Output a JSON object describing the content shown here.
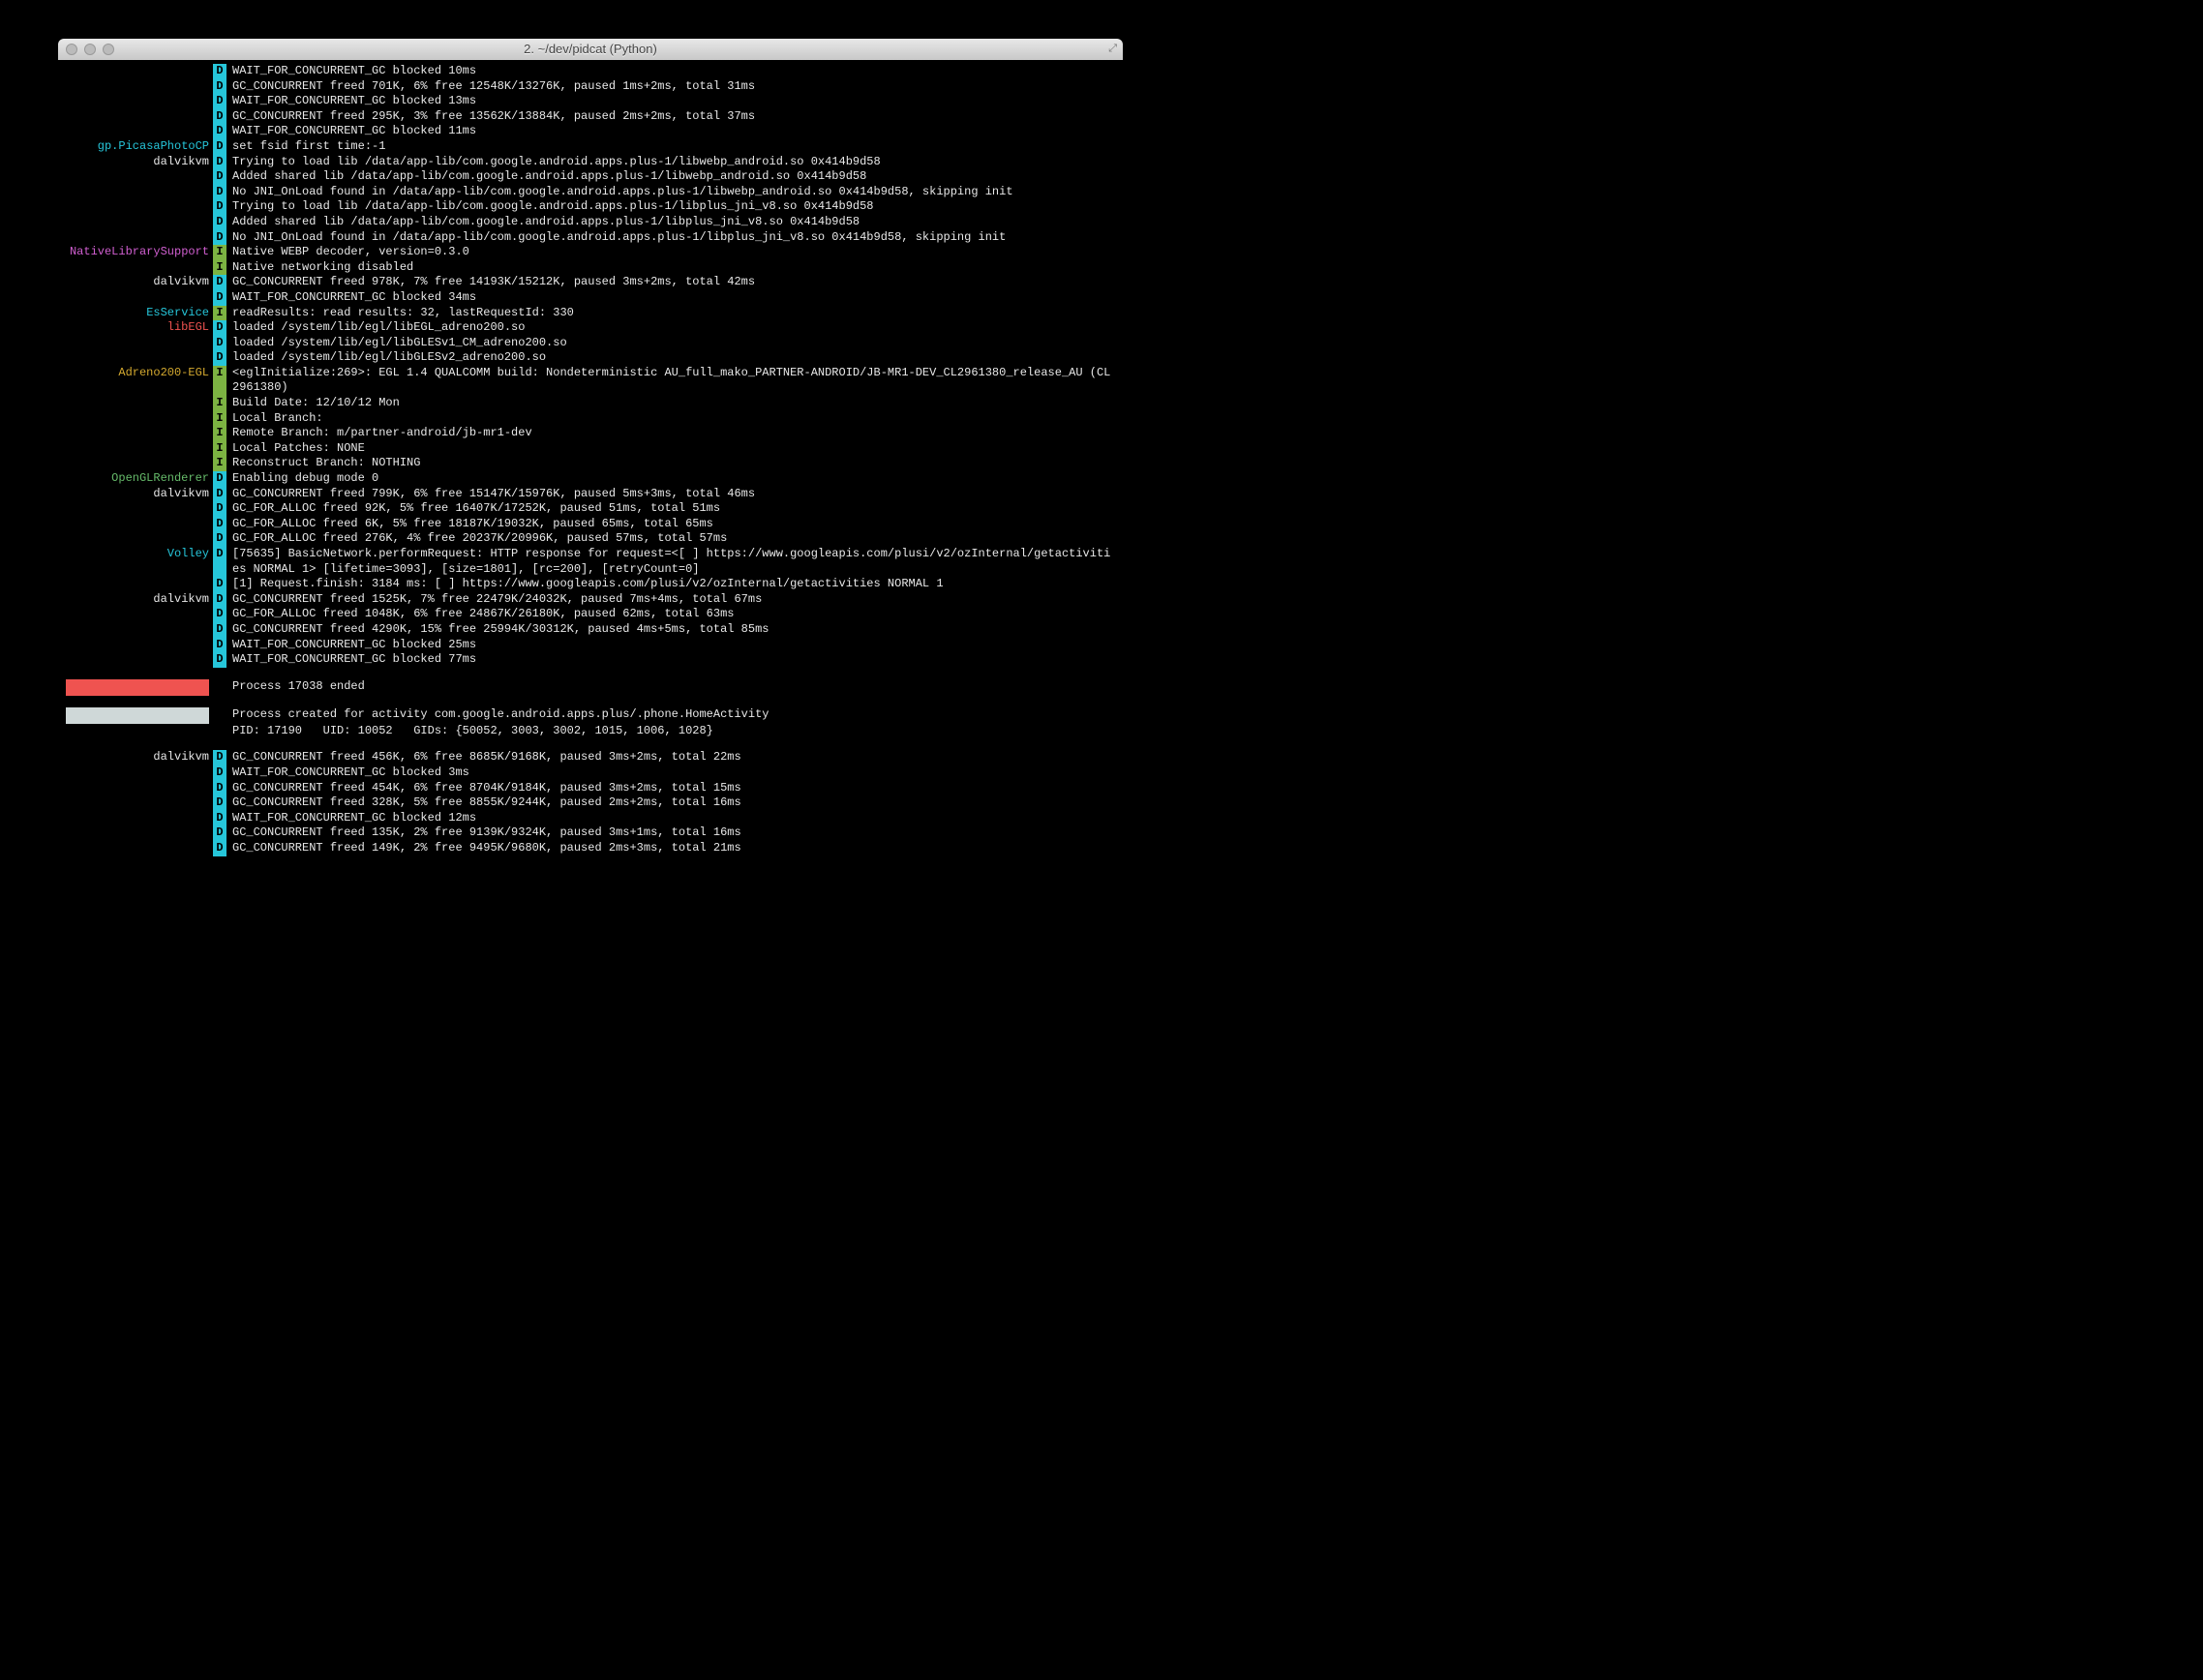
{
  "window": {
    "title": "2. ~/dev/pidcat (Python)"
  },
  "rows": [
    {
      "t": "row",
      "tag": "",
      "cls": "",
      "lvl": "D",
      "msg": "WAIT_FOR_CONCURRENT_GC blocked 10ms"
    },
    {
      "t": "row",
      "tag": "",
      "cls": "",
      "lvl": "D",
      "msg": "GC_CONCURRENT freed 701K, 6% free 12548K/13276K, paused 1ms+2ms, total 31ms"
    },
    {
      "t": "row",
      "tag": "",
      "cls": "",
      "lvl": "D",
      "msg": "WAIT_FOR_CONCURRENT_GC blocked 13ms"
    },
    {
      "t": "row",
      "tag": "",
      "cls": "",
      "lvl": "D",
      "msg": "GC_CONCURRENT freed 295K, 3% free 13562K/13884K, paused 2ms+2ms, total 37ms"
    },
    {
      "t": "row",
      "tag": "",
      "cls": "",
      "lvl": "D",
      "msg": "WAIT_FOR_CONCURRENT_GC blocked 11ms"
    },
    {
      "t": "row",
      "tag": "gp.PicasaPhotoCP",
      "cls": "cyan",
      "lvl": "D",
      "msg": "set fsid first time:-1"
    },
    {
      "t": "row",
      "tag": "dalvikvm",
      "cls": "white",
      "lvl": "D",
      "msg": "Trying to load lib /data/app-lib/com.google.android.apps.plus-1/libwebp_android.so 0x414b9d58"
    },
    {
      "t": "row",
      "tag": "",
      "cls": "",
      "lvl": "D",
      "msg": "Added shared lib /data/app-lib/com.google.android.apps.plus-1/libwebp_android.so 0x414b9d58"
    },
    {
      "t": "row",
      "tag": "",
      "cls": "",
      "lvl": "D",
      "msg": "No JNI_OnLoad found in /data/app-lib/com.google.android.apps.plus-1/libwebp_android.so 0x414b9d58, skipping init"
    },
    {
      "t": "row",
      "tag": "",
      "cls": "",
      "lvl": "D",
      "msg": "Trying to load lib /data/app-lib/com.google.android.apps.plus-1/libplus_jni_v8.so 0x414b9d58"
    },
    {
      "t": "row",
      "tag": "",
      "cls": "",
      "lvl": "D",
      "msg": "Added shared lib /data/app-lib/com.google.android.apps.plus-1/libplus_jni_v8.so 0x414b9d58"
    },
    {
      "t": "row",
      "tag": "",
      "cls": "",
      "lvl": "D",
      "msg": "No JNI_OnLoad found in /data/app-lib/com.google.android.apps.plus-1/libplus_jni_v8.so 0x414b9d58, skipping init"
    },
    {
      "t": "row",
      "tag": "NativeLibrarySupport",
      "cls": "magenta",
      "lvl": "I",
      "msg": "Native WEBP decoder, version=0.3.0"
    },
    {
      "t": "row",
      "tag": "",
      "cls": "",
      "lvl": "I",
      "msg": "Native networking disabled"
    },
    {
      "t": "row",
      "tag": "dalvikvm",
      "cls": "white",
      "lvl": "D",
      "msg": "GC_CONCURRENT freed 978K, 7% free 14193K/15212K, paused 3ms+2ms, total 42ms"
    },
    {
      "t": "row",
      "tag": "",
      "cls": "",
      "lvl": "D",
      "msg": "WAIT_FOR_CONCURRENT_GC blocked 34ms"
    },
    {
      "t": "row",
      "tag": "EsService",
      "cls": "cyan",
      "lvl": "I",
      "msg": "readResults: read results: 32, lastRequestId: 330"
    },
    {
      "t": "row",
      "tag": "libEGL",
      "cls": "red",
      "lvl": "D",
      "msg": "loaded /system/lib/egl/libEGL_adreno200.so"
    },
    {
      "t": "row",
      "tag": "",
      "cls": "",
      "lvl": "D",
      "msg": "loaded /system/lib/egl/libGLESv1_CM_adreno200.so"
    },
    {
      "t": "row",
      "tag": "",
      "cls": "",
      "lvl": "D",
      "msg": "loaded /system/lib/egl/libGLESv2_adreno200.so"
    },
    {
      "t": "row",
      "tag": "Adreno200-EGL",
      "cls": "yellow",
      "lvl": "I",
      "msg": "<eglInitialize:269>: EGL 1.4 QUALCOMM build: Nondeterministic AU_full_mako_PARTNER-ANDROID/JB-MR1-DEV_CL2961380_release_AU (CL2961380)"
    },
    {
      "t": "row",
      "tag": "",
      "cls": "",
      "lvl": "I",
      "msg": "Build Date: 12/10/12 Mon"
    },
    {
      "t": "row",
      "tag": "",
      "cls": "",
      "lvl": "I",
      "msg": "Local Branch:"
    },
    {
      "t": "row",
      "tag": "",
      "cls": "",
      "lvl": "I",
      "msg": "Remote Branch: m/partner-android/jb-mr1-dev"
    },
    {
      "t": "row",
      "tag": "",
      "cls": "",
      "lvl": "I",
      "msg": "Local Patches: NONE"
    },
    {
      "t": "row",
      "tag": "",
      "cls": "",
      "lvl": "I",
      "msg": "Reconstruct Branch: NOTHING"
    },
    {
      "t": "row",
      "tag": "OpenGLRenderer",
      "cls": "green",
      "lvl": "D",
      "msg": "Enabling debug mode 0"
    },
    {
      "t": "row",
      "tag": "dalvikvm",
      "cls": "white",
      "lvl": "D",
      "msg": "GC_CONCURRENT freed 799K, 6% free 15147K/15976K, paused 5ms+3ms, total 46ms"
    },
    {
      "t": "row",
      "tag": "",
      "cls": "",
      "lvl": "D",
      "msg": "GC_FOR_ALLOC freed 92K, 5% free 16407K/17252K, paused 51ms, total 51ms"
    },
    {
      "t": "row",
      "tag": "",
      "cls": "",
      "lvl": "D",
      "msg": "GC_FOR_ALLOC freed 6K, 5% free 18187K/19032K, paused 65ms, total 65ms"
    },
    {
      "t": "row",
      "tag": "",
      "cls": "",
      "lvl": "D",
      "msg": "GC_FOR_ALLOC freed 276K, 4% free 20237K/20996K, paused 57ms, total 57ms"
    },
    {
      "t": "row",
      "tag": "Volley",
      "cls": "cyan",
      "lvl": "D",
      "msg": "[75635] BasicNetwork.performRequest: HTTP response for request=<[ ] https://www.googleapis.com/plusi/v2/ozInternal/getactivities NORMAL 1> [lifetime=3093], [size=1801], [rc=200], [retryCount=0]"
    },
    {
      "t": "row",
      "tag": "",
      "cls": "",
      "lvl": "D",
      "msg": "[1] Request.finish: 3184 ms: [ ] https://www.googleapis.com/plusi/v2/ozInternal/getactivities NORMAL 1"
    },
    {
      "t": "row",
      "tag": "dalvikvm",
      "cls": "white",
      "lvl": "D",
      "msg": "GC_CONCURRENT freed 1525K, 7% free 22479K/24032K, paused 7ms+4ms, total 67ms"
    },
    {
      "t": "row",
      "tag": "",
      "cls": "",
      "lvl": "D",
      "msg": "GC_FOR_ALLOC freed 1048K, 6% free 24867K/26180K, paused 62ms, total 63ms"
    },
    {
      "t": "row",
      "tag": "",
      "cls": "",
      "lvl": "D",
      "msg": "GC_CONCURRENT freed 4290K, 15% free 25994K/30312K, paused 4ms+5ms, total 85ms"
    },
    {
      "t": "row",
      "tag": "",
      "cls": "",
      "lvl": "D",
      "msg": "WAIT_FOR_CONCURRENT_GC blocked 25ms"
    },
    {
      "t": "row",
      "tag": "",
      "cls": "",
      "lvl": "D",
      "msg": "WAIT_FOR_CONCURRENT_GC blocked 77ms"
    },
    {
      "t": "gap"
    },
    {
      "t": "banner",
      "color": "red",
      "msg": "Process 17038 ended"
    },
    {
      "t": "gap"
    },
    {
      "t": "banner",
      "color": "grey",
      "msg": "Process created for activity com.google.android.apps.plus/.phone.HomeActivity"
    },
    {
      "t": "plain",
      "msg": "PID: 17190   UID: 10052   GIDs: {50052, 3003, 3002, 1015, 1006, 1028}"
    },
    {
      "t": "gap"
    },
    {
      "t": "row",
      "tag": "dalvikvm",
      "cls": "white",
      "lvl": "D",
      "msg": "GC_CONCURRENT freed 456K, 6% free 8685K/9168K, paused 3ms+2ms, total 22ms"
    },
    {
      "t": "row",
      "tag": "",
      "cls": "",
      "lvl": "D",
      "msg": "WAIT_FOR_CONCURRENT_GC blocked 3ms"
    },
    {
      "t": "row",
      "tag": "",
      "cls": "",
      "lvl": "D",
      "msg": "GC_CONCURRENT freed 454K, 6% free 8704K/9184K, paused 3ms+2ms, total 15ms"
    },
    {
      "t": "row",
      "tag": "",
      "cls": "",
      "lvl": "D",
      "msg": "GC_CONCURRENT freed 328K, 5% free 8855K/9244K, paused 2ms+2ms, total 16ms"
    },
    {
      "t": "row",
      "tag": "",
      "cls": "",
      "lvl": "D",
      "msg": "WAIT_FOR_CONCURRENT_GC blocked 12ms"
    },
    {
      "t": "row",
      "tag": "",
      "cls": "",
      "lvl": "D",
      "msg": "GC_CONCURRENT freed 135K, 2% free 9139K/9324K, paused 3ms+1ms, total 16ms"
    },
    {
      "t": "row",
      "tag": "",
      "cls": "",
      "lvl": "D",
      "msg": "GC_CONCURRENT freed 149K, 2% free 9495K/9680K, paused 2ms+3ms, total 21ms"
    }
  ]
}
